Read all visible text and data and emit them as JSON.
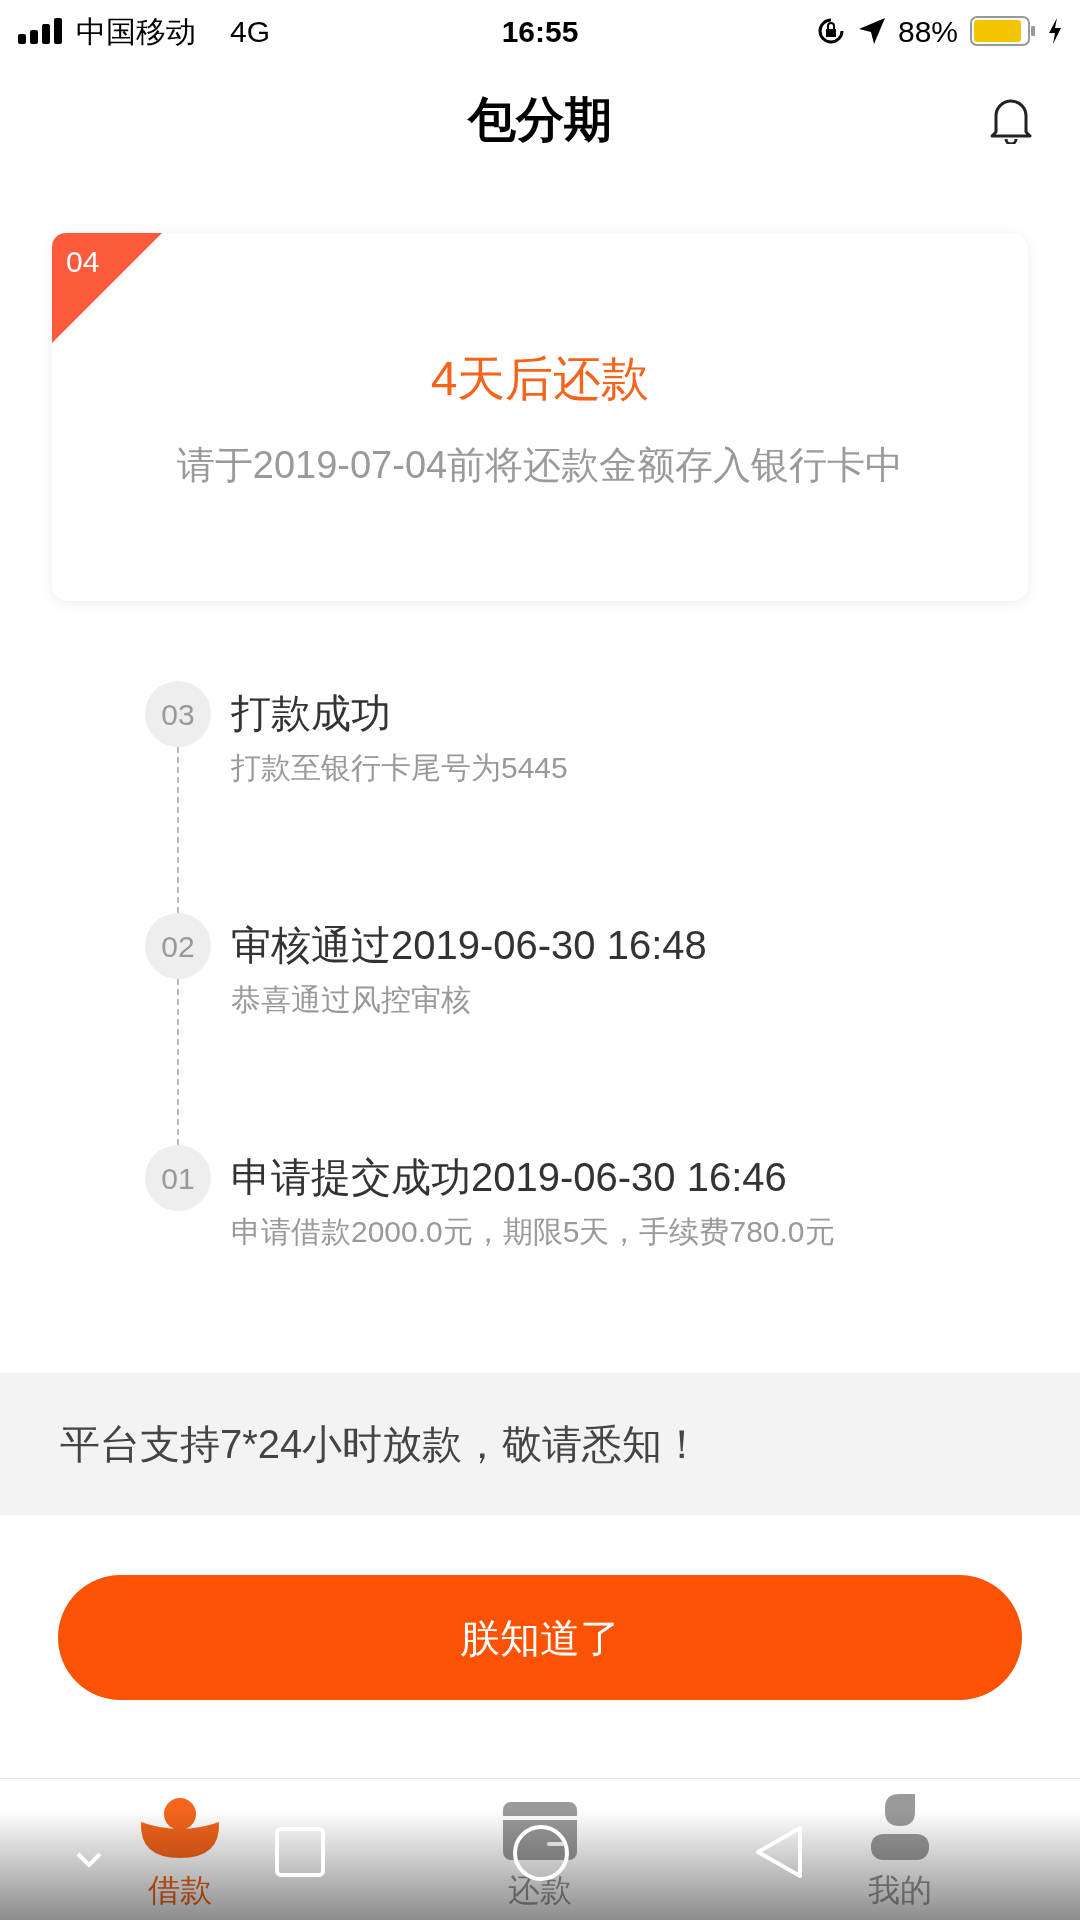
{
  "status_bar": {
    "carrier": "中国移动",
    "network": "4G",
    "time": "16:55",
    "battery": "88%"
  },
  "header": {
    "title": "包分期"
  },
  "card": {
    "badge": "04",
    "title": "4天后还款",
    "subtitle": "请于2019-07-04前将还款金额存入银行卡中"
  },
  "timeline": [
    {
      "step": "03",
      "title": "打款成功",
      "subtitle": "打款至银行卡尾号为5445"
    },
    {
      "step": "02",
      "title": "审核通过2019-06-30 16:48",
      "subtitle": "恭喜通过风控审核"
    },
    {
      "step": "01",
      "title": "申请提交成功2019-06-30 16:46",
      "subtitle": "申请借款2000.0元，期限5天，手续费780.0元"
    }
  ],
  "notice": "平台支持7*24小时放款，敬请悉知！",
  "button": "朕知道了",
  "tabs": [
    {
      "kind": "ingot",
      "label": "借款",
      "selected": true
    },
    {
      "kind": "card",
      "label": "还款",
      "selected": false
    },
    {
      "kind": "person",
      "label": "我的",
      "selected": false
    }
  ]
}
